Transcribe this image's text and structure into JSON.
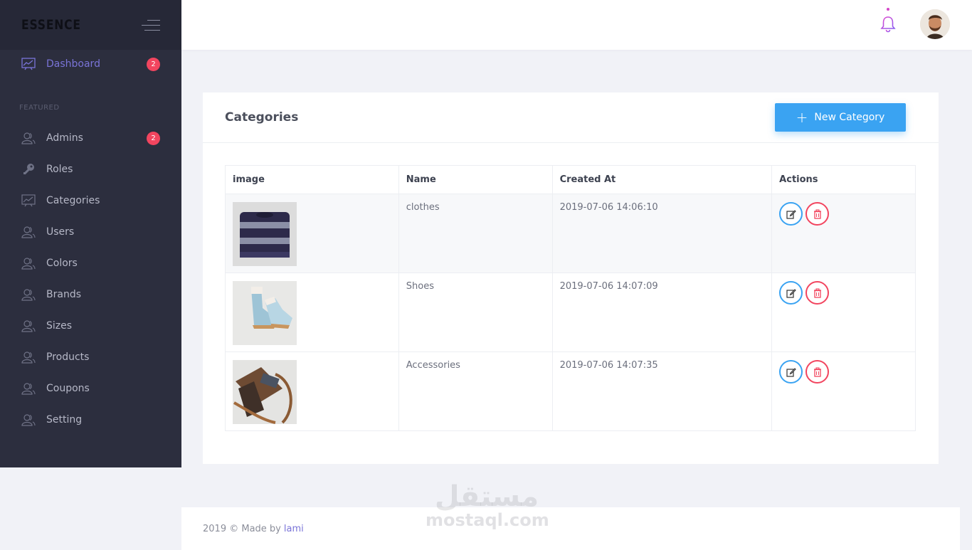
{
  "sidebar": {
    "brand": "ESSENCE",
    "section_label": "FEATURED",
    "items": [
      {
        "label": "Dashboard",
        "icon": "chart-icon",
        "badge": "2"
      },
      {
        "label": "Admins",
        "icon": "users-icon",
        "badge": "2"
      },
      {
        "label": "Roles",
        "icon": "key-icon"
      },
      {
        "label": "Categories",
        "icon": "chart-icon"
      },
      {
        "label": "Users",
        "icon": "users-icon"
      },
      {
        "label": "Colors",
        "icon": "users-icon"
      },
      {
        "label": "Brands",
        "icon": "users-icon"
      },
      {
        "label": "Sizes",
        "icon": "users-icon"
      },
      {
        "label": "Products",
        "icon": "users-icon"
      },
      {
        "label": "Coupons",
        "icon": "users-icon"
      },
      {
        "label": "Setting",
        "icon": "users-icon"
      }
    ]
  },
  "header": {
    "notification_icon": "bell-icon",
    "avatar_icon": "user-avatar"
  },
  "card": {
    "title": "Categories",
    "new_button": "New Category",
    "columns": [
      "image",
      "Name",
      "Created At",
      "Actions"
    ],
    "rows": [
      {
        "name": "clothes",
        "created_at": "2019-07-06 14:06:10",
        "image": "sweater"
      },
      {
        "name": "Shoes",
        "created_at": "2019-07-06 14:07:09",
        "image": "boots"
      },
      {
        "name": "Accessories",
        "created_at": "2019-07-06 14:07:35",
        "image": "bag"
      }
    ]
  },
  "footer": {
    "text": "2019 © Made by",
    "author": "lami"
  },
  "watermark": {
    "arabic": "مستقل",
    "latin": "mostaql.com"
  },
  "colors": {
    "sidebar_bg": "#2c2e3e",
    "accent_purple": "#7a74d8",
    "primary_blue": "#3aa3f2",
    "danger_red": "#f2455f"
  }
}
